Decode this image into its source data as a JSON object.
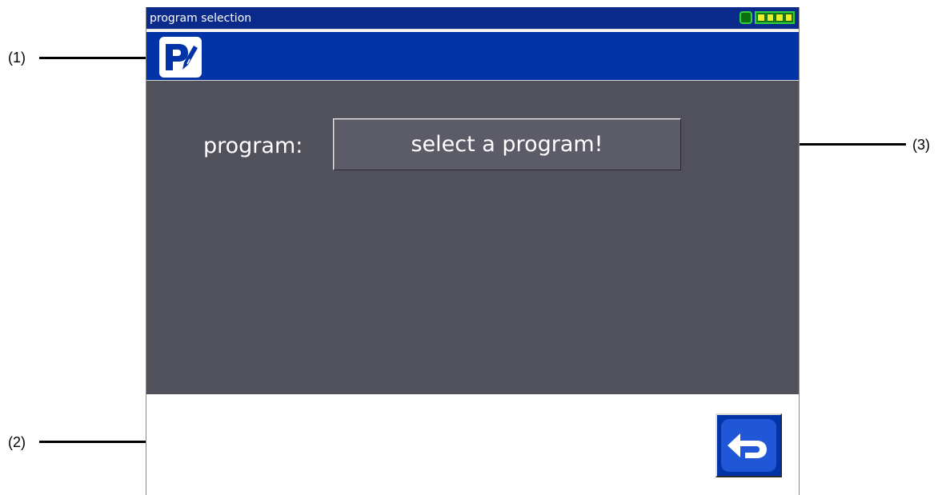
{
  "callouts": {
    "c1": "(1)",
    "c2": "(2)",
    "c3": "(3)"
  },
  "window": {
    "title": "program selection",
    "status_icons": [
      "power-icon",
      "battery-icon"
    ]
  },
  "header": {
    "icon": "program-edit-icon"
  },
  "main": {
    "program_label": "program:",
    "program_value": "select a program!"
  },
  "footer": {
    "back_icon": "back-arrow-icon"
  },
  "colors": {
    "title_bar": "#0a2b8c",
    "header_bar": "#0334a7",
    "content_bg": "#51515c",
    "status_green": "#2fd03a"
  }
}
